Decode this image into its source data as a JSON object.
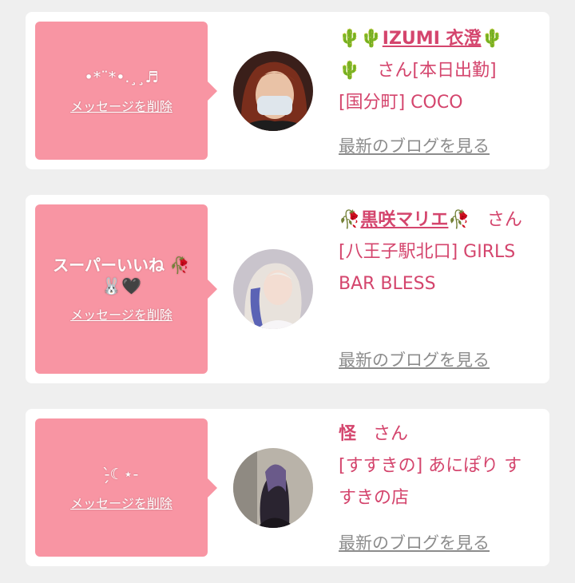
{
  "delete_label": "メッセージを削除",
  "blog_label": "最新のブログを見る",
  "san": "さん",
  "cards": [
    {
      "message": "•*¨*•.¸¸♬",
      "name": "IZUMI 衣澄",
      "shop": "[国分町] COCO"
    },
    {
      "message": "スーパーいいね 🥀 🐰🖤",
      "name": "黒咲マリエ",
      "shop": "[八王子駅北口] GIRLS BAR BLESS"
    },
    {
      "message": "-̗̀☾⋆-",
      "name": "怪",
      "shop": "[すすきの] あにぽり すすきの店"
    }
  ],
  "colors": {
    "bubble": "#f895a3",
    "accent": "#d4456d",
    "link_gray": "#8c8c8c",
    "background": "#efefef"
  }
}
